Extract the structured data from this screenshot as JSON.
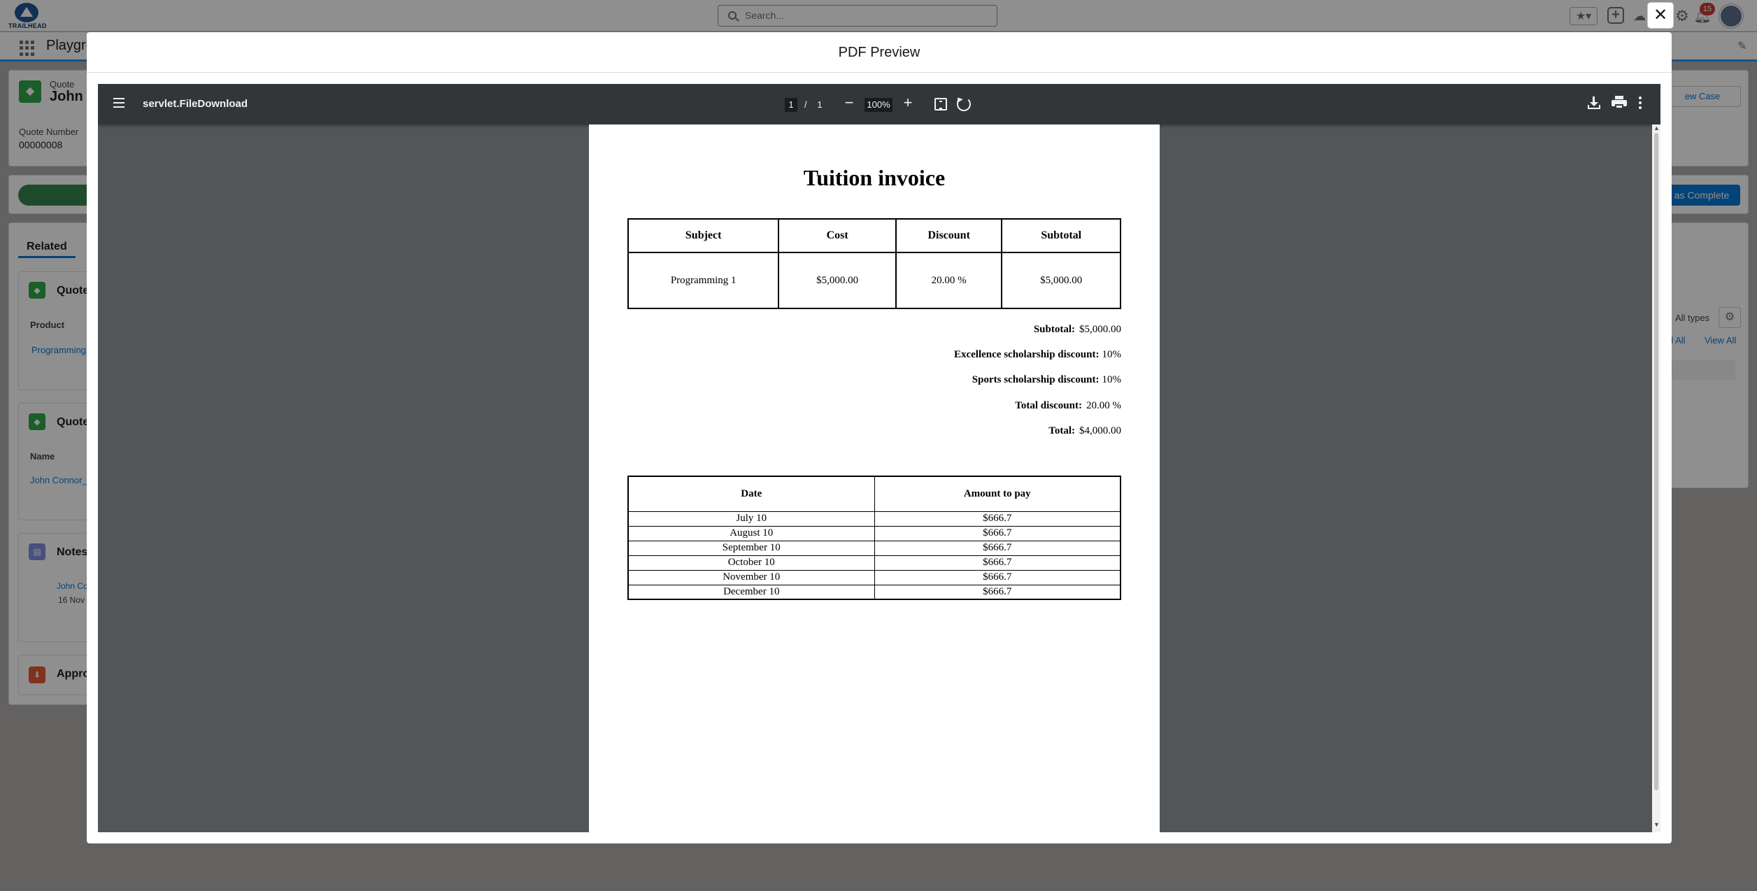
{
  "global_header": {
    "logo_text": "TRAILHEAD",
    "search_placeholder": "Search...",
    "notification_count": "15"
  },
  "app_nav": {
    "app_name": "Playgro"
  },
  "record": {
    "object_label": "Quote",
    "name": "John C",
    "quote_number_label": "Quote Number",
    "quote_number": "00000008",
    "mark_complete_button": "as Complete",
    "new_case_button": "ew Case"
  },
  "related": {
    "tab_label": "Related",
    "quote_lines_title": "Quote",
    "product_column": "Product",
    "product_value": "Programming",
    "quote_docs_title": "Quote",
    "name_column": "Name",
    "name_value": "John Connor_",
    "notes_title": "Notes",
    "note_author": "John Co",
    "note_date": "16 Nov",
    "approvals_title": "Appro"
  },
  "activity": {
    "filter_text": "All types",
    "expand_all": "d All",
    "view_all": "View All"
  },
  "modal": {
    "title": "PDF Preview",
    "close_label": "✕"
  },
  "viewer": {
    "file_name": "servlet.FileDownload",
    "current_page": "1",
    "page_separator": "/",
    "total_pages": "1",
    "zoom": "100%",
    "zoom_out": "−",
    "zoom_in": "+"
  },
  "invoice": {
    "title": "Tuition invoice",
    "items_headers": [
      "Subject",
      "Cost",
      "Discount",
      "Subtotal"
    ],
    "items": [
      {
        "subject": "Programming 1",
        "cost": "$5,000.00",
        "discount": "20.00 %",
        "subtotal": "$5,000.00"
      }
    ],
    "summary": [
      {
        "label": "Subtotal:",
        "value": "$5,000.00"
      },
      {
        "label": "Excellence scholarship discount:",
        "value": "10%"
      },
      {
        "label": "Sports scholarship discount:",
        "value": "10%"
      },
      {
        "label": "Total discount:",
        "value": "20.00 %"
      },
      {
        "label": "Total:",
        "value": "$4,000.00"
      }
    ],
    "schedule_headers": [
      "Date",
      "Amount to pay"
    ],
    "schedule": [
      {
        "date": "July 10",
        "amount": "$666.7"
      },
      {
        "date": "August 10",
        "amount": "$666.7"
      },
      {
        "date": "September 10",
        "amount": "$666.7"
      },
      {
        "date": "October 10",
        "amount": "$666.7"
      },
      {
        "date": "November 10",
        "amount": "$666.7"
      },
      {
        "date": "December 10",
        "amount": "$666.7"
      }
    ]
  }
}
